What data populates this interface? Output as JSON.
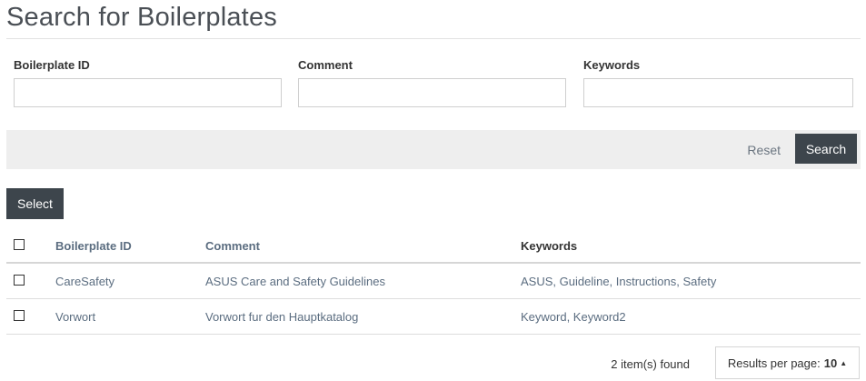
{
  "page": {
    "title": "Search for Boilerplates"
  },
  "form": {
    "fields": [
      {
        "label": "Boilerplate ID",
        "value": "",
        "placeholder": ""
      },
      {
        "label": "Comment",
        "value": "",
        "placeholder": ""
      },
      {
        "label": "Keywords",
        "value": "",
        "placeholder": ""
      }
    ],
    "reset_label": "Reset",
    "search_label": "Search"
  },
  "results": {
    "select_label": "Select",
    "columns": [
      "Boilerplate ID",
      "Comment",
      "Keywords"
    ],
    "rows": [
      {
        "id": "CareSafety",
        "comment": "ASUS Care and Safety Guidelines",
        "keywords": "ASUS, Guideline, Instructions, Safety"
      },
      {
        "id": "Vorwort",
        "comment": "Vorwort fur den Hauptkatalog",
        "keywords": "Keyword, Keyword2"
      }
    ],
    "found_text": "2 item(s) found",
    "per_page_label": "Results per page:",
    "per_page_value": "10",
    "caret_icon": "caret-up-icon"
  }
}
